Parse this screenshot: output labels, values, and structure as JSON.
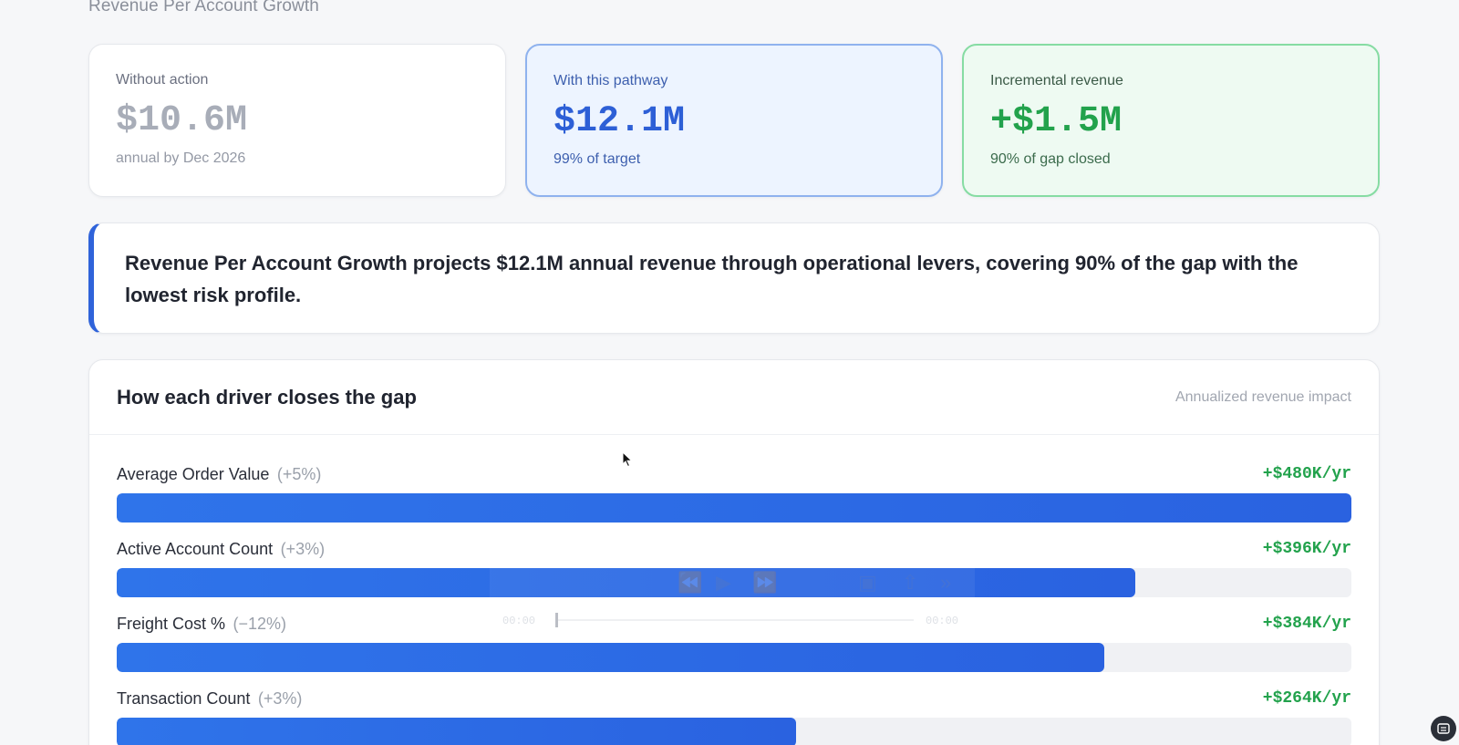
{
  "page": {
    "title": "Revenue Per Account Growth"
  },
  "stats": [
    {
      "label": "Without action",
      "value": "$10.6M",
      "sub": "annual by Dec 2026"
    },
    {
      "label": "With this pathway",
      "value": "$12.1M",
      "sub": "99% of target"
    },
    {
      "label": "Incremental revenue",
      "value": "+$1.5M",
      "sub": "90% of gap closed"
    }
  ],
  "summary": {
    "text": "Revenue Per Account Growth projects $12.1M annual revenue through operational levers, covering 90% of the gap with the lowest risk profile."
  },
  "drivers": {
    "title": "How each driver closes the gap",
    "caption": "Annualized revenue impact",
    "items": [
      {
        "name": "Average Order Value",
        "delta": "(+5%)",
        "impact": "+$480K/yr",
        "fill_pct": 100
      },
      {
        "name": "Active Account Count",
        "delta": "(+3%)",
        "impact": "+$396K/yr",
        "fill_pct": 82.5
      },
      {
        "name": "Freight Cost %",
        "delta": "(−12%)",
        "impact": "+$384K/yr",
        "fill_pct": 80
      },
      {
        "name": "Transaction Count",
        "delta": "(+3%)",
        "impact": "+$264K/yr",
        "fill_pct": 55
      }
    ]
  },
  "video_overlay": {
    "time_start": "00:00",
    "time_end": "00:00"
  },
  "colors": {
    "accent": "#2f63da",
    "positive": "#22a24c",
    "muted": "#a8adb8"
  },
  "icons": {
    "corner": "screen-capture-icon",
    "cursor": "cursor-icon"
  }
}
